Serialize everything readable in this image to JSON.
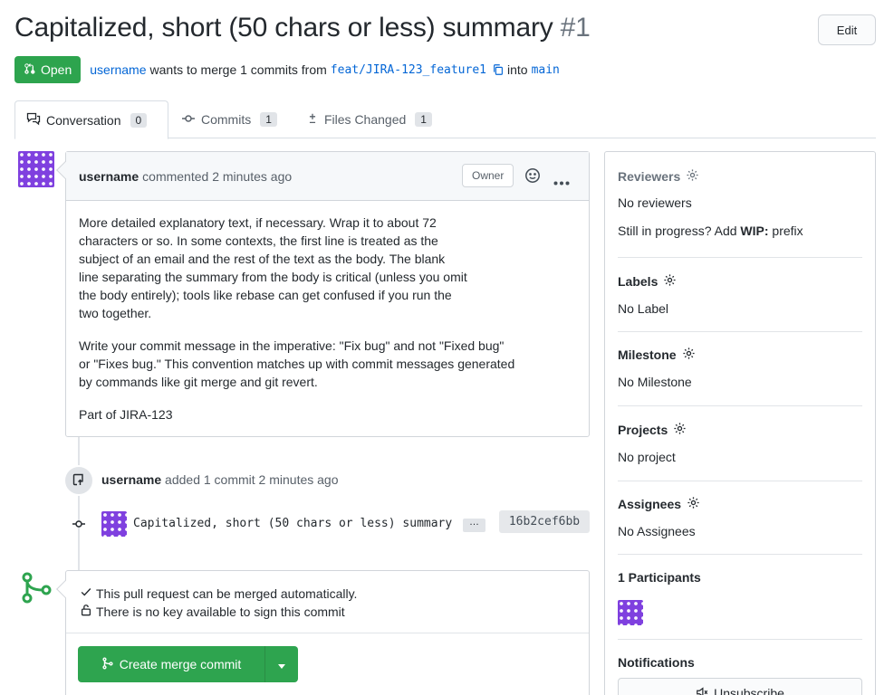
{
  "header": {
    "title": "Capitalized, short (50 chars or less) summary",
    "number": "#1",
    "edit_label": "Edit"
  },
  "status": {
    "state_label": "Open",
    "author": "username",
    "text_merge": "wants to merge 1 commits from",
    "head_branch": "feat/JIRA-123_feature1",
    "text_into": "into",
    "base_branch": "main"
  },
  "tabs": [
    {
      "label": "Conversation",
      "count": "0"
    },
    {
      "label": "Commits",
      "count": "1"
    },
    {
      "label": "Files Changed",
      "count": "1"
    }
  ],
  "comment": {
    "author": "username",
    "meta": "commented 2 minutes ago",
    "role": "Owner",
    "body_lines_p1": [
      "More detailed explanatory text, if necessary. Wrap it to about 72",
      "characters or so. In some contexts, the first line is treated as the",
      "subject of an email and the rest of the text as the body. The blank",
      "line separating the summary from the body is critical (unless you omit",
      "the body entirely); tools like rebase can get confused if you run the",
      "two together."
    ],
    "body_lines_p2": [
      "Write your commit message in the imperative: \"Fix bug\" and not \"Fixed bug\"",
      "or \"Fixes bug.\" This convention matches up with commit messages generated",
      "by commands like git merge and git revert."
    ],
    "body_p3": "Part of JIRA-123"
  },
  "timeline": {
    "push_author": "username",
    "push_meta": "added 1 commit 2 minutes ago",
    "commit_message": "Capitalized, short (50 chars or less) summary",
    "commit_ellipsis": "…",
    "commit_sha": "16b2cef6bb"
  },
  "merge": {
    "status_auto": "This pull request can be merged automatically.",
    "status_sign": "There is no key available to sign this commit",
    "button_label": "Create merge commit"
  },
  "sidebar": {
    "reviewers_label": "Reviewers",
    "reviewers_value": "No reviewers",
    "wip_text": "Still in progress? Add",
    "wip_bold": "WIP:",
    "wip_suffix": "prefix",
    "labels_label": "Labels",
    "labels_value": "No Label",
    "milestone_label": "Milestone",
    "milestone_value": "No Milestone",
    "projects_label": "Projects",
    "projects_value": "No project",
    "assignees_label": "Assignees",
    "assignees_value": "No Assignees",
    "participants_label": "1 Participants",
    "notifications_label": "Notifications",
    "unsubscribe_label": "Unsubscribe"
  },
  "colors": {
    "accent_green": "#2da44e",
    "link_blue": "#0366d6",
    "avatar_purple": "#7f40df"
  }
}
